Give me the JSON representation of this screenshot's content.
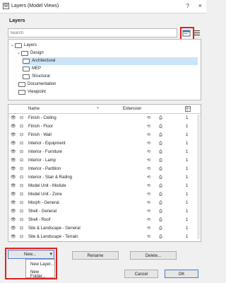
{
  "window": {
    "title": "Layers (Model Views)",
    "help": "?",
    "close": "×"
  },
  "section_title": "Layers",
  "search": {
    "placeholder": "Search",
    "value": ""
  },
  "tree": [
    {
      "label": "Layers",
      "expanded": true,
      "selected": false
    },
    {
      "label": "Design",
      "expanded": true,
      "selected": false
    },
    {
      "label": "Architectural",
      "expanded": false,
      "selected": true
    },
    {
      "label": "MEP",
      "expanded": false,
      "selected": false
    },
    {
      "label": "Structural",
      "expanded": false,
      "selected": false
    },
    {
      "label": "Documentation",
      "expanded": false,
      "selected": false
    },
    {
      "label": "Viewpoint",
      "expanded": false,
      "selected": false
    }
  ],
  "table": {
    "headers": {
      "name": "Name",
      "extension": "Extension"
    },
    "rows": [
      {
        "name": "Finish - Ceiling",
        "value": "1"
      },
      {
        "name": "Finish - Floor",
        "value": "1"
      },
      {
        "name": "Finish - Wall",
        "value": "1"
      },
      {
        "name": "Interior - Equipment",
        "value": "1"
      },
      {
        "name": "Interior - Furniture",
        "value": "1"
      },
      {
        "name": "Interior - Lamp",
        "value": "1"
      },
      {
        "name": "Interior - Partition",
        "value": "1"
      },
      {
        "name": "Interior - Stair & Railing",
        "value": "1"
      },
      {
        "name": "Model Unit - Module",
        "value": "1"
      },
      {
        "name": "Model Unit - Zone",
        "value": "1"
      },
      {
        "name": "Morph - General",
        "value": "1"
      },
      {
        "name": "Shell - General",
        "value": "1"
      },
      {
        "name": "Shell - Roof",
        "value": "1"
      },
      {
        "name": "Site & Landscape - General",
        "value": "1"
      },
      {
        "name": "Site & Landscape - Terrain",
        "value": "1"
      }
    ]
  },
  "buttons": {
    "new": "New...",
    "rename": "Rename",
    "delete": "Delete...",
    "cancel": "Cancel",
    "ok": "OK"
  },
  "new_menu": {
    "new_layer": "New Layer...",
    "new_folder": "New Folder..."
  },
  "colors": {
    "highlight": "#e02020",
    "selection": "#cce4f7",
    "focus": "#4a7bd0"
  }
}
